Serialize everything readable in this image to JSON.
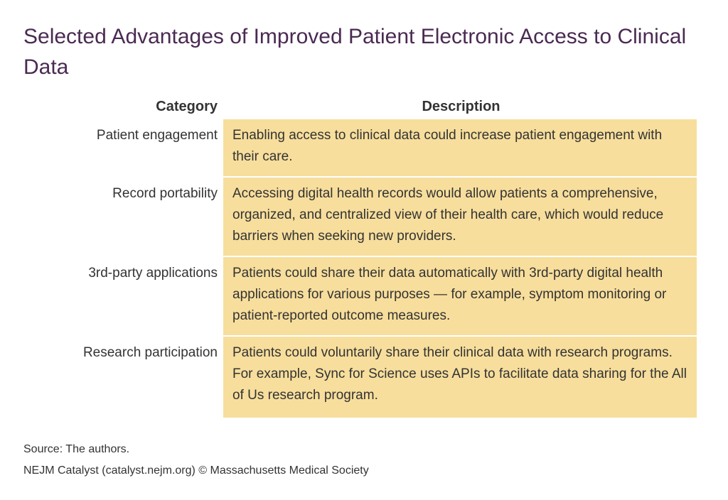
{
  "title": "Selected Advantages of Improved Patient Electronic Access to Clinical Data",
  "table": {
    "headers": {
      "category": "Category",
      "description": "Description"
    },
    "rows": [
      {
        "category": "Patient engagement",
        "description": "Enabling access to clinical data could increase patient engagement with their care."
      },
      {
        "category": "Record portability",
        "description": "Accessing digital health records would allow patients a comprehensive, organized, and centralized view of their health care, which would reduce barriers when seeking new providers."
      },
      {
        "category": "3rd-party applications",
        "description": "Patients could share their data automatically with 3rd-party digital health applications for various purposes — for example, symptom monitoring or patient-reported outcome measures."
      },
      {
        "category": "Research participation",
        "description": "Patients could voluntarily share their clinical data with research programs. For example, Sync for Science uses APIs to facilitate data sharing for the All of Us research program."
      }
    ]
  },
  "footer": {
    "source": "Source: The authors.",
    "credit": "NEJM Catalyst (catalyst.nejm.org) © Massachusetts Medical Society"
  },
  "colors": {
    "title": "#4a2a52",
    "cell_background": "#f7de9c",
    "text": "#333333"
  }
}
